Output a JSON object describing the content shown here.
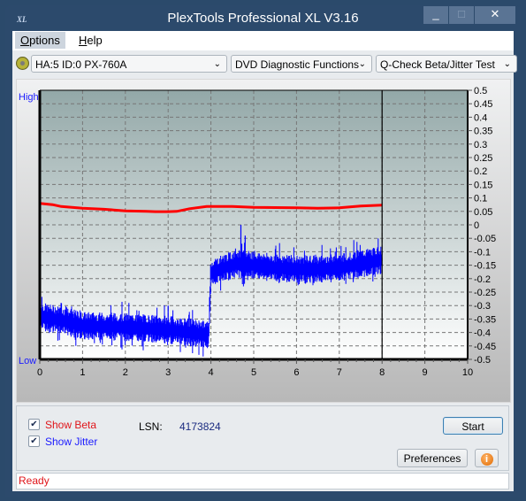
{
  "window": {
    "title": "PlexTools Professional XL V3.16",
    "app_icon_text": "XL",
    "controls": {
      "minimize": "_",
      "maximize": "□",
      "close": "✕"
    }
  },
  "menu": {
    "items": [
      {
        "label": "Options",
        "mnemonic": "O"
      },
      {
        "label": "Help",
        "mnemonic": "H"
      }
    ]
  },
  "toolbar": {
    "drive_select": "HA:5 ID:0  PX-760A",
    "function_select": "DVD Diagnostic Functions",
    "test_select": "Q-Check Beta/Jitter Test",
    "dropdown_arrow": "⌄"
  },
  "chart_data": {
    "type": "line",
    "title": "",
    "left_axis_labels": {
      "top": "High",
      "bottom": "Low"
    },
    "xlabel": "",
    "ylabel": "",
    "x_ticks": [
      0,
      1,
      2,
      3,
      4,
      5,
      6,
      7,
      8,
      9,
      10
    ],
    "x_range": [
      0,
      10
    ],
    "y_right_ticks": [
      "0.5",
      "0.45",
      "0.4",
      "0.35",
      "0.3",
      "0.25",
      "0.2",
      "0.15",
      "0.1",
      "0.05",
      "0",
      "-0.05",
      "-0.1",
      "-0.15",
      "-0.2",
      "-0.25",
      "-0.3",
      "-0.35",
      "-0.4",
      "-0.45",
      "-0.5"
    ],
    "y_range": [
      -0.5,
      0.5
    ],
    "grid": true,
    "progress_marker_x": 8.0,
    "colors": {
      "beta": "#ff0000",
      "jitter": "#0000ff",
      "plot_bg_top": "#93a8a8",
      "plot_bg_bottom": "#ffffff"
    },
    "series": [
      {
        "name": "Beta",
        "x": [
          0,
          0.3,
          0.5,
          1.0,
          1.5,
          2.0,
          2.5,
          2.7,
          3.0,
          3.2,
          3.5,
          3.9,
          4.0,
          4.5,
          5.0,
          5.5,
          6.0,
          6.5,
          7.0,
          7.5,
          8.0
        ],
        "y": [
          0.08,
          0.075,
          0.068,
          0.062,
          0.058,
          0.052,
          0.05,
          0.049,
          0.049,
          0.05,
          0.06,
          0.068,
          0.068,
          0.068,
          0.065,
          0.064,
          0.063,
          0.062,
          0.063,
          0.07,
          0.073
        ]
      },
      {
        "name": "Jitter",
        "x": [
          0,
          0.5,
          1.0,
          1.5,
          2.0,
          2.5,
          3.0,
          3.5,
          3.95,
          4.0,
          4.3,
          4.6,
          5.0,
          5.5,
          6.0,
          6.5,
          7.0,
          7.5,
          8.0
        ],
        "y": [
          -0.34,
          -0.355,
          -0.375,
          -0.378,
          -0.38,
          -0.385,
          -0.39,
          -0.4,
          -0.41,
          -0.18,
          -0.16,
          -0.145,
          -0.15,
          -0.16,
          -0.165,
          -0.165,
          -0.16,
          -0.145,
          -0.13
        ],
        "noise_amplitude": 0.04,
        "spikes": [
          {
            "x": 3.0,
            "y": -0.3
          },
          {
            "x": 4.7,
            "y": 0.0
          },
          {
            "x": 4.8,
            "y": -0.04
          }
        ]
      }
    ]
  },
  "options": {
    "show_beta": {
      "label": "Show Beta",
      "mnemonic": "B",
      "checked": true
    },
    "show_jitter": {
      "label": "Show Jitter",
      "mnemonic": "J",
      "checked": true
    },
    "check_mark": "✔"
  },
  "lsn": {
    "label": "LSN:",
    "value": "4173824"
  },
  "buttons": {
    "start": "Start",
    "preferences": "Preferences",
    "info_icon": "i"
  },
  "status": {
    "text": "Ready"
  }
}
